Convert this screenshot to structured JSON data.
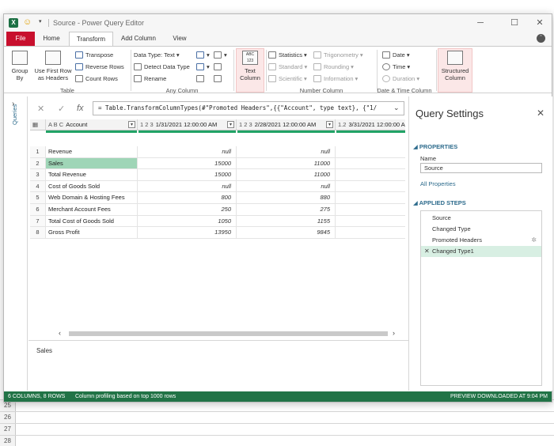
{
  "window": {
    "title": "Source - Power Query Editor",
    "minimize": "─",
    "maximize": "☐",
    "close": "✕"
  },
  "tabs": [
    "File",
    "Home",
    "Transform",
    "Add Column",
    "View"
  ],
  "ribbon": {
    "table_group": {
      "label": "Table",
      "group_by": [
        "Group",
        "By"
      ],
      "use_first_row": [
        "Use First Row",
        "as Headers"
      ],
      "transpose": "Transpose",
      "reverse_rows": "Reverse Rows",
      "count_rows": "Count Rows"
    },
    "any_column_group": {
      "label": "Any Column",
      "data_type": "Data Type: Text",
      "detect_data_type": "Detect Data Type",
      "rename": "Rename"
    },
    "text_column": [
      "Text",
      "Column"
    ],
    "number_column_group": {
      "label": "Number Column",
      "statistics": "Statistics",
      "standard": "Standard",
      "scientific": "Scientific",
      "trigonometry": "Trigonometry",
      "rounding": "Rounding",
      "information": "Information"
    },
    "datetime_group": {
      "label": "Date & Time Column",
      "date": "Date",
      "time": "Time",
      "duration": "Duration"
    },
    "structured_column": [
      "Structured",
      "Column"
    ]
  },
  "queries_label": "Queries",
  "formula": "= Table.TransformColumnTypes(#\"Promoted Headers\",{{\"Account\", type text}, {\"1/",
  "grid": {
    "headers": [
      {
        "type": "A B C",
        "name": "Account"
      },
      {
        "type": "1 2 3",
        "name": "1/31/2021 12:00:00 AM"
      },
      {
        "type": "1 2 3",
        "name": "2/28/2021 12:00:00 AM"
      },
      {
        "type": "1.2",
        "name": "3/31/2021 12:00:00 A"
      }
    ],
    "rows": [
      {
        "idx": "1",
        "account": "Revenue",
        "jan": "null",
        "feb": "null"
      },
      {
        "idx": "2",
        "account": "Sales",
        "jan": "15000",
        "feb": "11000"
      },
      {
        "idx": "3",
        "account": "Total Revenue",
        "jan": "15000",
        "feb": "11000"
      },
      {
        "idx": "4",
        "account": "Cost of Goods Sold",
        "jan": "null",
        "feb": "null"
      },
      {
        "idx": "5",
        "account": "Web Domain & Hosting Fees",
        "jan": "800",
        "feb": "880"
      },
      {
        "idx": "6",
        "account": "Merchant Account Fees",
        "jan": "250",
        "feb": "275"
      },
      {
        "idx": "7",
        "account": "Total Cost of Goods Sold",
        "jan": "1050",
        "feb": "1155"
      },
      {
        "idx": "8",
        "account": "Gross Profit",
        "jan": "13950",
        "feb": "9845"
      }
    ]
  },
  "preview_value": "Sales",
  "settings": {
    "title": "Query Settings",
    "properties_label": "PROPERTIES",
    "name_label": "Name",
    "name_value": "Source",
    "all_properties": "All Properties",
    "applied_steps_label": "APPLIED STEPS",
    "steps": [
      "Source",
      "Changed Type",
      "Promoted Headers",
      "Changed Type1"
    ]
  },
  "status": {
    "left": "6 COLUMNS, 8 ROWS",
    "middle": "Column profiling based on top 1000 rows",
    "right": "PREVIEW DOWNLOADED AT 9:04 PM"
  },
  "sheet_rows": [
    "25",
    "26",
    "27",
    "28"
  ],
  "colors": {
    "accent_green": "#217346",
    "file_tab": "#c8102e",
    "link": "#2d6b8c",
    "selected_cell": "#9fd5b7"
  }
}
